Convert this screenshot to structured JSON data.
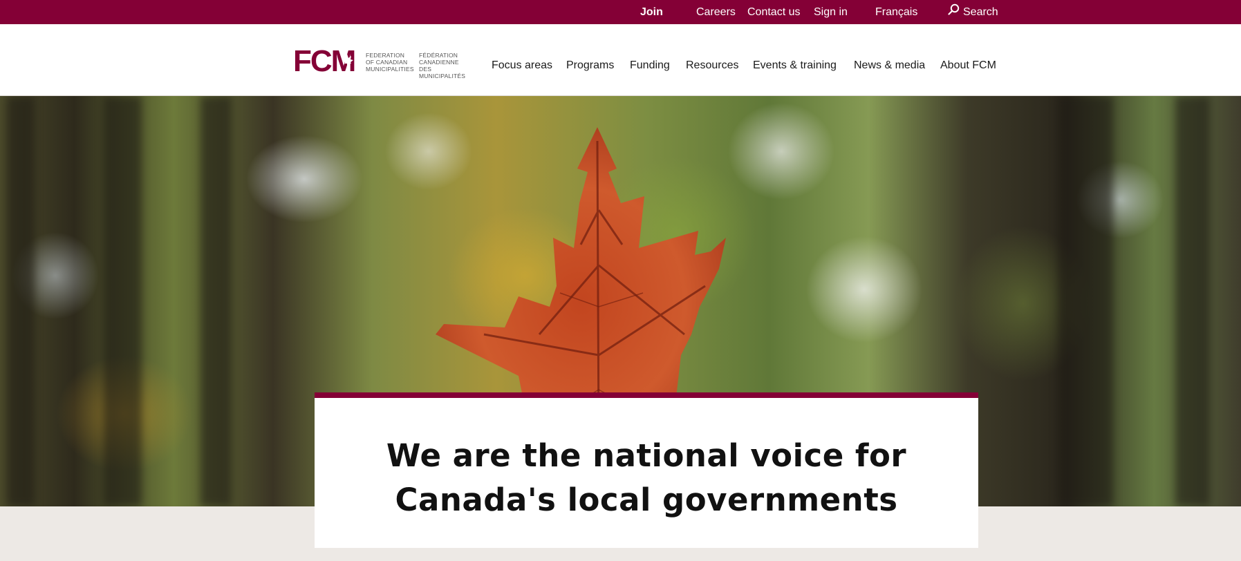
{
  "utility_nav": {
    "join": "Join",
    "careers": "Careers",
    "contact": "Contact us",
    "sign_in": "Sign in",
    "language": "Français",
    "search": "Search",
    "search_icon": "magnifier-icon"
  },
  "logo": {
    "mark": "FCM",
    "text_en": "FEDERATION\nOF CANADIAN\nMUNICIPALITIES",
    "text_fr": "FÉDÉRATION\nCANADIENNE DES\nMUNICIPALITÉS"
  },
  "main_nav": {
    "items": [
      "Focus areas",
      "Programs",
      "Funding",
      "Resources",
      "Events & training",
      "News & media",
      "About FCM"
    ]
  },
  "hero": {
    "image": "maple-leaf-forest-photo",
    "headline_line1": "We are the national voice for",
    "headline_line2": "Canada's local governments"
  },
  "colors": {
    "brand": "#840036",
    "page_background": "#ede9e5"
  }
}
